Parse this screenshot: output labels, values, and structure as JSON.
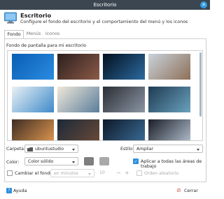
{
  "window": {
    "title": "Escritorio"
  },
  "header": {
    "title": "Escritorio",
    "subtitle": "Configure el fondo del escritorio y el comportamiento del menú y los iconos"
  },
  "tabs": [
    {
      "label": "Fondo",
      "active": true
    },
    {
      "label": "Menús",
      "active": false
    },
    {
      "label": "Iconos",
      "active": false
    }
  ],
  "background": {
    "section_title": "Fondo de pantalla para mi escritorio",
    "wallpapers": [
      {
        "name": "wallpaper-1",
        "colors": [
          "#0a5fb4",
          "#2a8be0"
        ]
      },
      {
        "name": "wallpaper-2",
        "colors": [
          "#2b1f1e",
          "#8c5a48"
        ]
      },
      {
        "name": "wallpaper-3",
        "colors": [
          "#04101e",
          "#2b6aa0"
        ]
      },
      {
        "name": "wallpaper-4",
        "colors": [
          "#c9d3db",
          "#8e6f58"
        ]
      },
      {
        "name": "wallpaper-5",
        "colors": [
          "#e9f1f5",
          "#3f8ac9"
        ]
      },
      {
        "name": "wallpaper-6",
        "colors": [
          "#f0e8d8",
          "#5a7d9c"
        ]
      },
      {
        "name": "wallpaper-7",
        "colors": [
          "#2a2d33",
          "#8a96a4"
        ]
      },
      {
        "name": "wallpaper-8",
        "colors": [
          "#1e3b52",
          "#6aa1bd"
        ]
      },
      {
        "name": "wallpaper-9",
        "colors": [
          "#3d2c22",
          "#e59b52"
        ]
      },
      {
        "name": "wallpaper-10",
        "colors": [
          "#1b2a3a",
          "#6d4a36"
        ]
      },
      {
        "name": "wallpaper-11",
        "colors": [
          "#0e1828",
          "#3c6f9a"
        ]
      },
      {
        "name": "wallpaper-12",
        "colors": [
          "#1a1e27",
          "#b6c3d3"
        ]
      }
    ],
    "folder_label": "Carpeta:",
    "folder_value": "ubuntustudio",
    "style_label": "Estilo:",
    "style_value": "Ampliar",
    "color_label": "Color:",
    "color_value": "Color sólido",
    "apply_all_label": "Aplicar a todas las áreas de trabajo",
    "apply_all_checked": true,
    "change_bg_label": "Cambiar el fondo",
    "change_bg_checked": false,
    "interval_unit": "en minutos",
    "interval_value": "10",
    "random_order_label": "Orden aleatorio",
    "swatch_colors": [
      "#7f7f7f",
      "#a8a8a8"
    ]
  },
  "footer": {
    "help_label": "Ayuda",
    "close_label": "Cerrar"
  }
}
